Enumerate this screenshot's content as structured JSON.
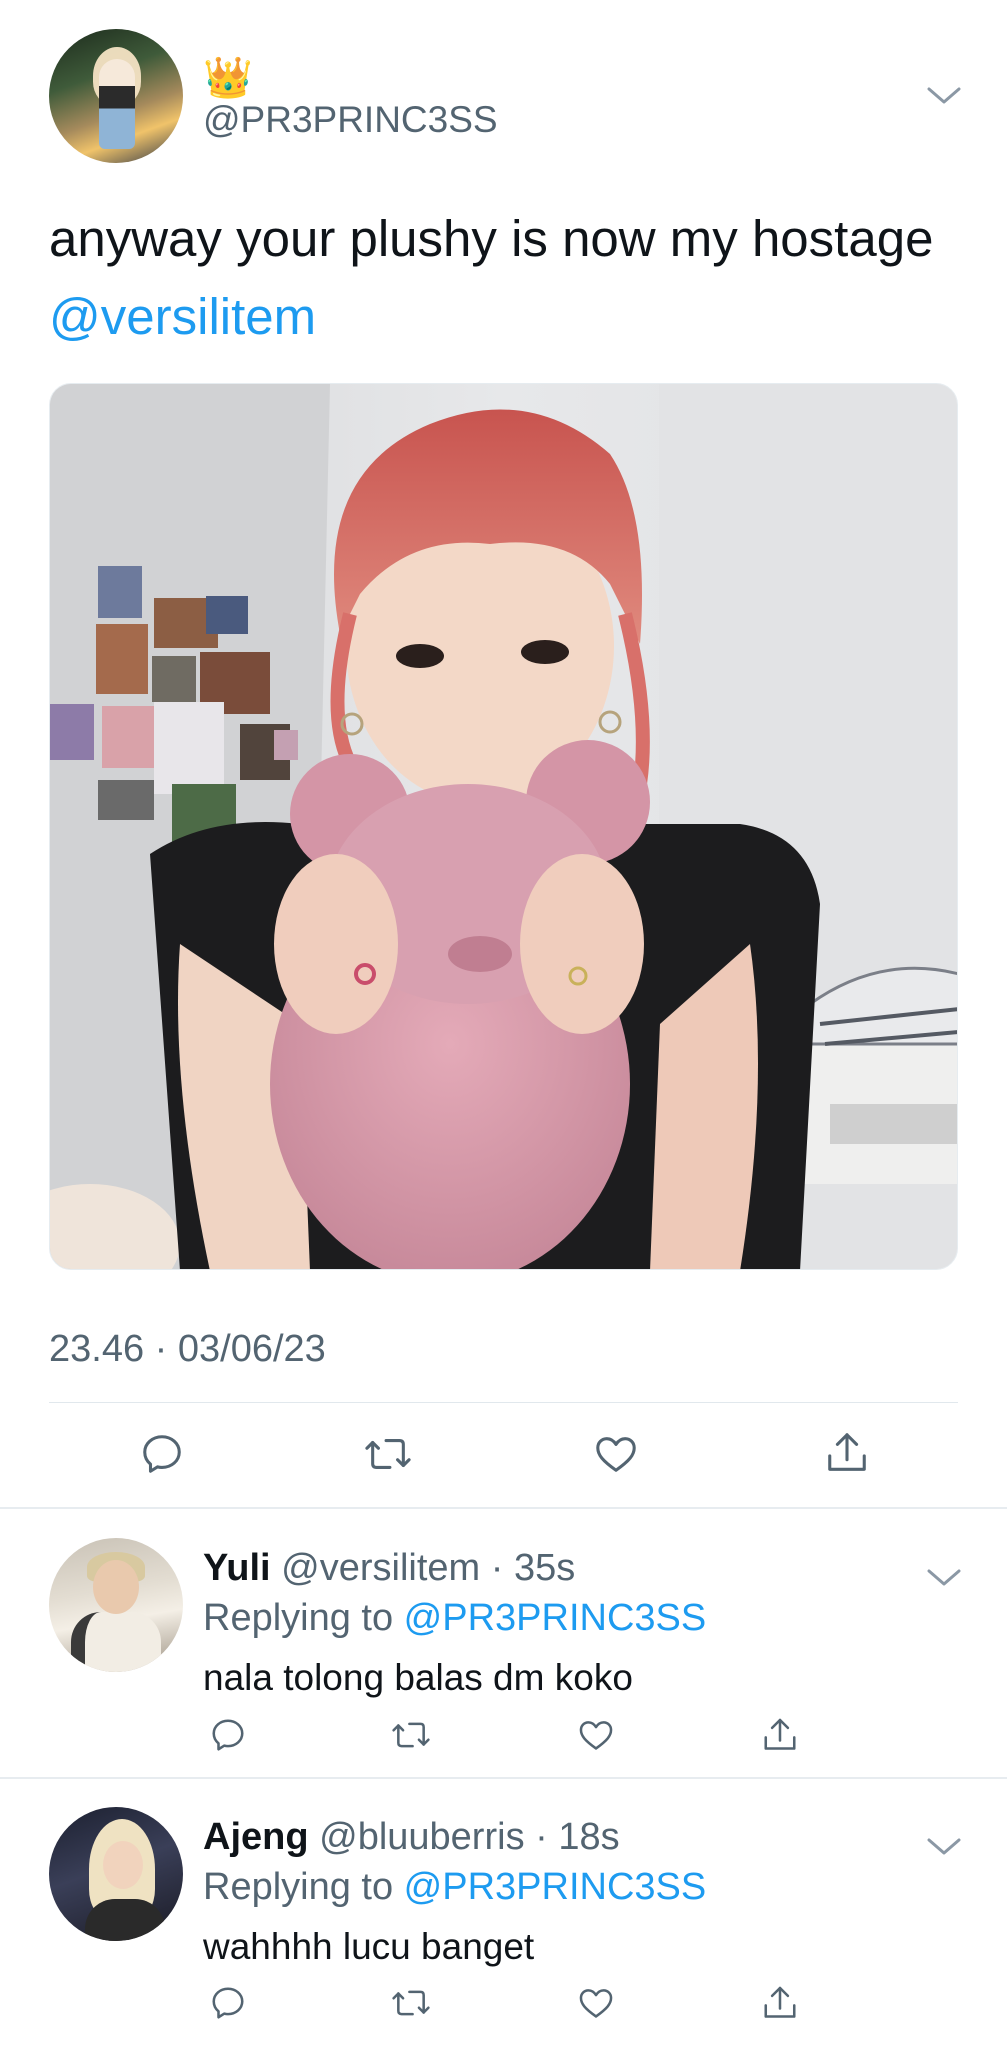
{
  "main_tweet": {
    "crown_emoji": "👑",
    "handle": "@PR3PRINC3SS",
    "text_before": "anyway your plushy is now my hostage ",
    "text_mention": "@versilitem",
    "timestamp": "23.46 · 03/06/23",
    "avatar_icon": "profile-photo",
    "media_description_icon": "photo"
  },
  "replies": [
    {
      "name": "Yuli",
      "meta": "@versilitem · 35s",
      "replying_prefix": "Replying to ",
      "replying_to": "@PR3PRINC3SS",
      "text": "nala tolong balas dm koko"
    },
    {
      "name": "Ajeng",
      "meta": "@bluuberris · 18s",
      "replying_prefix": "Replying to ",
      "replying_to": "@PR3PRINC3SS",
      "text": "wahhhh lucu banget"
    }
  ],
  "actions": {
    "icons": [
      "reply-icon",
      "retweet-icon",
      "like-icon",
      "share-icon"
    ]
  },
  "colors": {
    "text": "#0f1419",
    "secondary": "#536471",
    "link": "#1d9bf0",
    "divider": "#e7ecf0"
  }
}
